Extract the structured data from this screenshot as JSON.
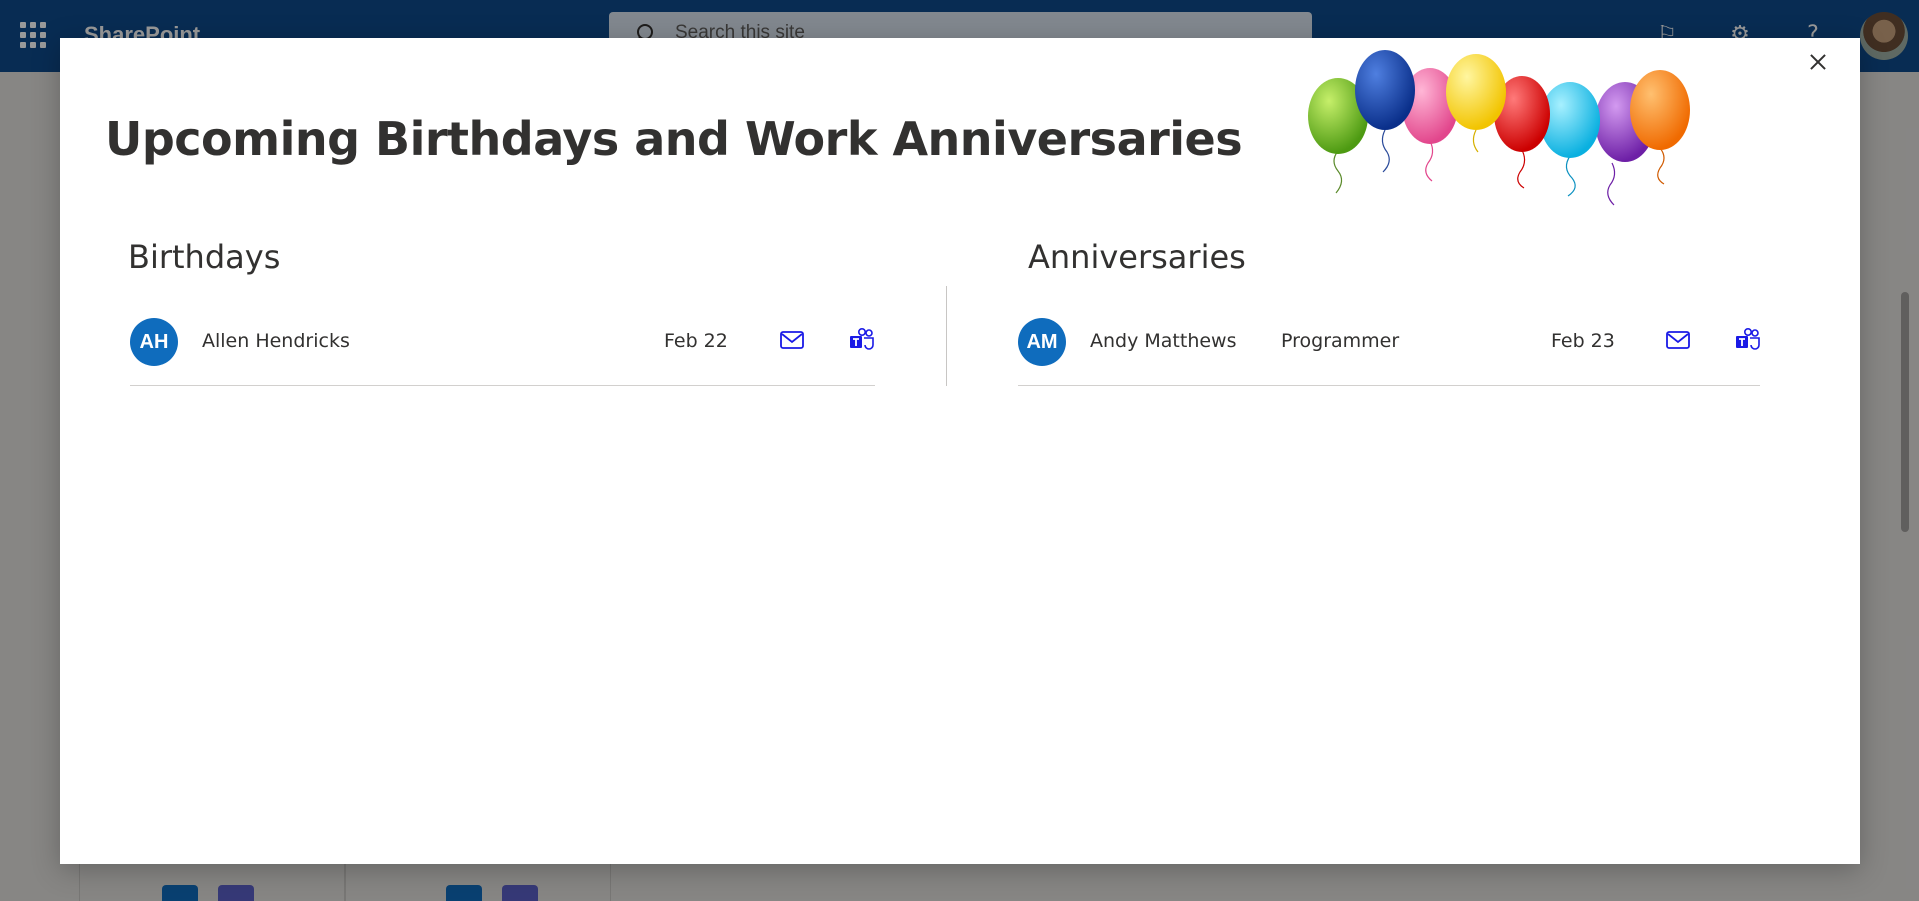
{
  "suitebar": {
    "app_name": "SharePoint",
    "search_placeholder": "Search this site",
    "brand_color": "#0e4a8a"
  },
  "dialog": {
    "title": "Upcoming Birthdays and Work Anniversaries",
    "close_icon": "close-icon",
    "birthdays": {
      "heading": "Birthdays",
      "items": [
        {
          "initials": "AH",
          "name": "Allen Hendricks",
          "date": "Feb 22",
          "mail_icon": "mail-icon",
          "teams_icon": "teams-icon"
        }
      ]
    },
    "anniversaries": {
      "heading": "Anniversaries",
      "items": [
        {
          "initials": "AM",
          "name": "Andy Matthews",
          "job_title": "Programmer",
          "date": "Feb 23",
          "mail_icon": "mail-icon",
          "teams_icon": "teams-icon"
        }
      ]
    }
  },
  "colors": {
    "avatar": "#0f6cbd",
    "icon_blue": "#1a1ae6"
  }
}
